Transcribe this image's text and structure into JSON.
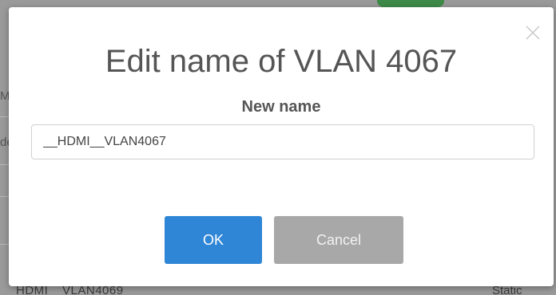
{
  "background": {
    "row_text_left": "HDMI__VLAN4069",
    "row_text_right": "Static",
    "fragment_1": "M",
    "fragment_2": "de"
  },
  "dialog": {
    "title": "Edit name of VLAN 4067",
    "field_label": "New name",
    "field_value": "__HDMI__VLAN4067",
    "ok_label": "OK",
    "cancel_label": "Cancel"
  },
  "colors": {
    "primary": "#2f86d6",
    "secondary": "#a8a8a8",
    "text": "#555555"
  },
  "icons": {
    "close": "close-icon"
  }
}
